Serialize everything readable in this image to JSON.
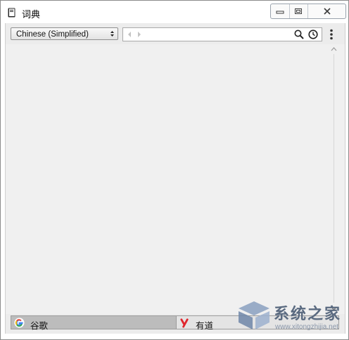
{
  "window": {
    "title": "词典",
    "controls": [
      "minimize-icon",
      "restore-icon",
      "close-icon"
    ]
  },
  "toolbar": {
    "language_selected": "Chinese (Simplified)",
    "search_placeholder": "",
    "search_value": ""
  },
  "tabs": [
    {
      "label": "谷歌",
      "icon": "google-icon",
      "active": true
    },
    {
      "label": "有道",
      "icon": "youdao-icon",
      "active": false
    }
  ],
  "watermark": {
    "text": "系统之家",
    "url": "www.xitongzhijia.net"
  },
  "colors": {
    "content_bg": "#f0f0f0",
    "active_tab": "#bcbcbc",
    "google_blue": "#4285f4",
    "youdao_red": "#e0262d"
  }
}
